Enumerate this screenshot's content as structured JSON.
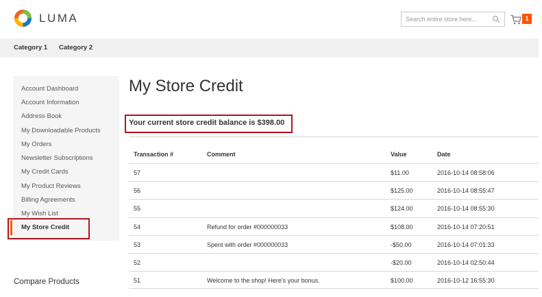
{
  "header": {
    "logo_text": "LUMA",
    "search_placeholder": "Search entire store here...",
    "cart_count": "1",
    "colors": {
      "accent": "#ff5501",
      "highlight_box": "#b0131f"
    }
  },
  "nav": {
    "items": [
      {
        "label": "Category 1"
      },
      {
        "label": "Category 2"
      }
    ]
  },
  "sidebar": {
    "items": [
      {
        "label": "Account Dashboard"
      },
      {
        "label": "Account Information"
      },
      {
        "label": "Address Book"
      },
      {
        "label": "My Downloadable Products"
      },
      {
        "label": "My Orders"
      },
      {
        "label": "Newsletter Subscriptions"
      },
      {
        "label": "My Credit Cards"
      },
      {
        "label": "My Product Reviews"
      },
      {
        "label": "Billing Agreements"
      },
      {
        "label": "My Wish List"
      }
    ],
    "current": {
      "label": "My Store Credit"
    },
    "compare_title": "Compare Products"
  },
  "main": {
    "title": "My Store Credit",
    "balance_prefix": "Your current store credit balance is ",
    "balance_amount": "$398.00",
    "table": {
      "headers": [
        "Transaction #",
        "Comment",
        "Value",
        "Date"
      ],
      "rows": [
        {
          "id": "57",
          "comment": "",
          "value": "$11.00",
          "date": "2016-10-14 08:58:06"
        },
        {
          "id": "56",
          "comment": "",
          "value": "$125.00",
          "date": "2016-10-14 08:55:47"
        },
        {
          "id": "55",
          "comment": "",
          "value": "$124.00",
          "date": "2016-10-14 08:55:30"
        },
        {
          "id": "54",
          "comment": "Refund for order #000000033",
          "value": "$108.00",
          "date": "2016-10-14 07:20:51"
        },
        {
          "id": "53",
          "comment": "Spent with order #000000033",
          "value": "-$50.00",
          "date": "2016-10-14 07:01:33"
        },
        {
          "id": "52",
          "comment": "",
          "value": "-$20.00",
          "date": "2016-10-14 02:50:44"
        },
        {
          "id": "51",
          "comment": "Welcome to the shop! Here's your bonus.",
          "value": "$100.00",
          "date": "2016-10-12 16:55:30"
        }
      ]
    }
  }
}
